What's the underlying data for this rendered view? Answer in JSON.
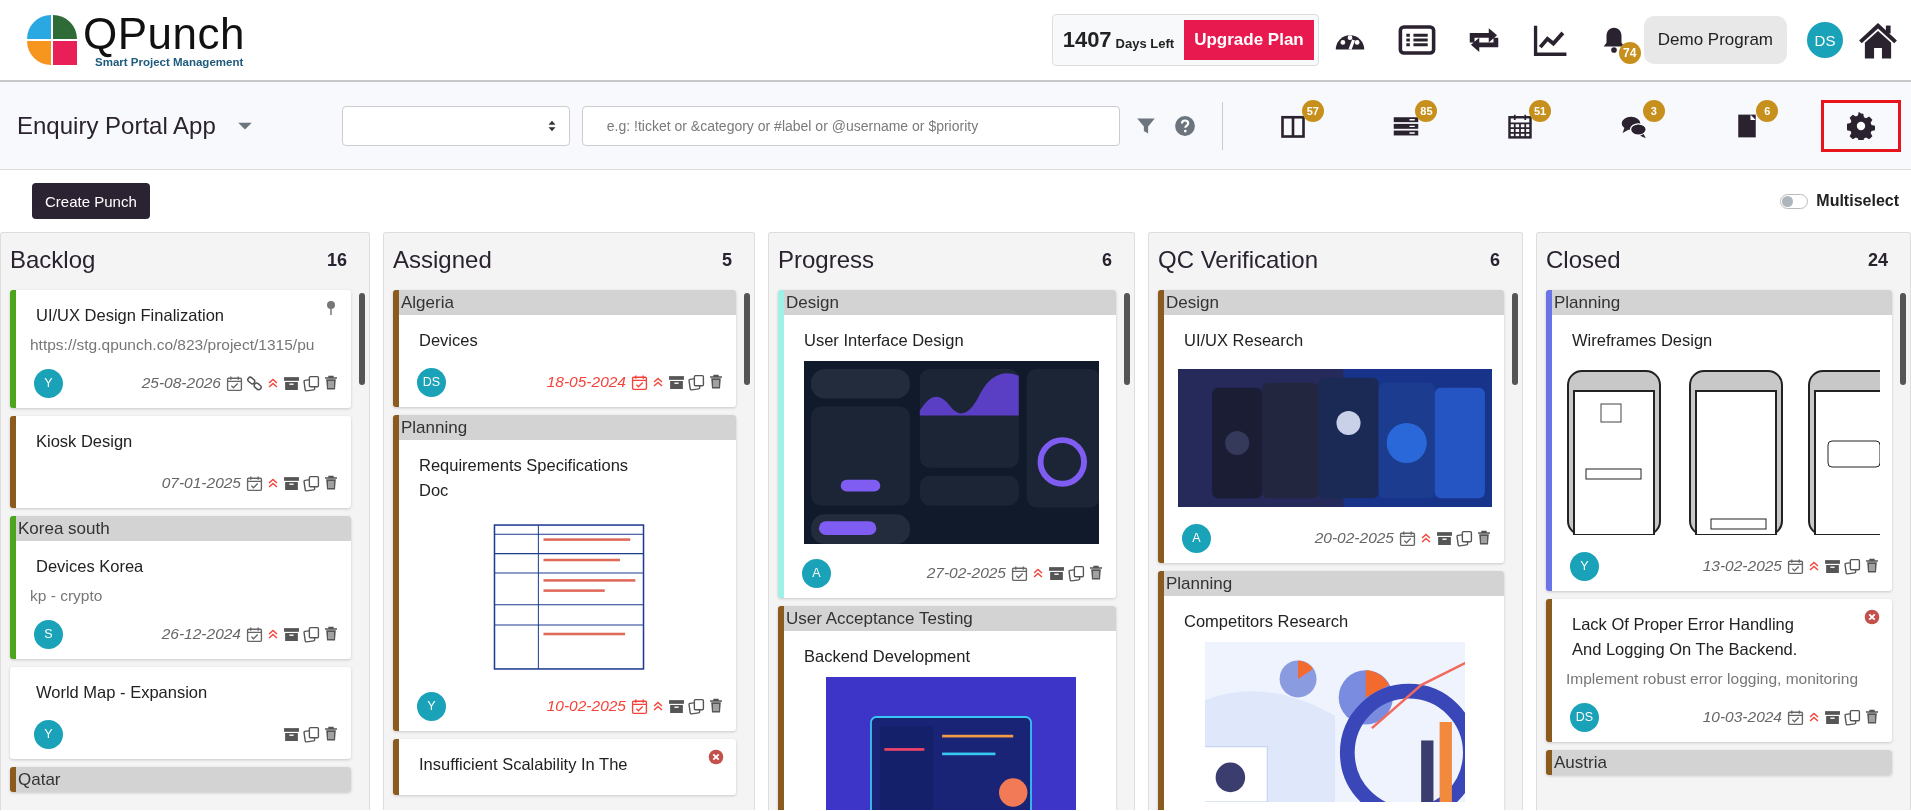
{
  "brand": {
    "name": "QPunch",
    "tagline": "Smart Project Management"
  },
  "plan": {
    "days": "1407",
    "days_label": "Days Left",
    "upgrade": "Upgrade Plan"
  },
  "nav_icons": [
    {
      "kind": "dashboard"
    },
    {
      "kind": "list"
    },
    {
      "kind": "repeat"
    },
    {
      "kind": "chart"
    },
    {
      "kind": "bell",
      "badge": "74"
    }
  ],
  "program": "Demo Program",
  "user": {
    "initials": "DS"
  },
  "project": {
    "title": "Enquiry Portal App"
  },
  "search": {
    "placeholder": "e.g: !ticket or &category or #label or @username or $priority"
  },
  "view_icons": [
    {
      "kind": "board",
      "badge": "57",
      "selected": false
    },
    {
      "kind": "stack",
      "badge": "85",
      "selected": false
    },
    {
      "kind": "calendar",
      "badge": "51",
      "selected": false
    },
    {
      "kind": "chat",
      "badge": "3",
      "selected": false
    },
    {
      "kind": "note",
      "badge": "6",
      "selected": false
    },
    {
      "kind": "settings",
      "selected": true
    }
  ],
  "create_button": "Create Punch",
  "multiselect": {
    "label": "Multiselect",
    "on": false
  },
  "columns": [
    {
      "title": "Backlog",
      "count": "16",
      "cards": [
        {
          "color": "#4ca51c",
          "title": "UI/UX Design Finalization",
          "subtitle": "https://stg.qpunch.co/823/project/1315/pu",
          "avatar": "Y",
          "date": "25-08-2026",
          "overdue": false,
          "pinned": true,
          "link": true,
          "priority": true,
          "cancel": false
        },
        {
          "color": "#8b5a1e",
          "title": "Kiosk Design",
          "date": "07-01-2025",
          "overdue": false,
          "pinned": false,
          "link": false,
          "priority": true,
          "cancel": false
        },
        {
          "group": "Korea south",
          "color": "#4ca51c",
          "title": "Devices Korea",
          "subtitle": "kp - crypto",
          "avatar": "S",
          "date": "26-12-2024",
          "overdue": false,
          "pinned": false,
          "link": false,
          "priority": true,
          "cancel": false
        },
        {
          "color": "#ffffff",
          "title": "World Map - Expansion",
          "avatar": "Y",
          "pinned": false,
          "link": false,
          "priority": false,
          "cancel": false
        },
        {
          "group": "Qatar",
          "color": "#8b5a1e"
        }
      ]
    },
    {
      "title": "Assigned",
      "count": "5",
      "cards": [
        {
          "group": "Algeria",
          "color": "#8b5a1e",
          "title": "Devices",
          "avatar": "DS",
          "date": "18-05-2024",
          "overdue": true,
          "pinned": false,
          "link": false,
          "priority": true,
          "cancel": false
        },
        {
          "group": "Planning",
          "color": "#8b5a1e",
          "title": "Requirements Specifications Doc",
          "avatar": "Y",
          "date": "10-02-2025",
          "overdue": true,
          "pinned": false,
          "link": false,
          "priority": true,
          "cancel": false
        },
        {
          "color": "#8b5a1e",
          "title": "Insufficient Scalability In The",
          "cancel": true
        }
      ]
    },
    {
      "title": "Progress",
      "count": "6",
      "cards": [
        {
          "group": "Design",
          "color": "#9ff0e6",
          "title": "User Interface Design",
          "avatar": "A",
          "date": "27-02-2025",
          "overdue": false,
          "pinned": false,
          "link": false,
          "priority": true,
          "cancel": false
        },
        {
          "group": "User Acceptance Testing",
          "color": "#8b5a1e",
          "title": "Backend Development"
        }
      ]
    },
    {
      "title": "QC Verification",
      "count": "6",
      "cards": [
        {
          "group": "Design",
          "color": "#8b5a1e",
          "title": "UI/UX Research",
          "avatar": "A",
          "date": "20-02-2025",
          "overdue": false,
          "pinned": false,
          "link": false,
          "priority": true,
          "cancel": false
        },
        {
          "group": "Planning",
          "color": "#8b5a1e",
          "title": "Competitors Research"
        }
      ]
    },
    {
      "title": "Closed",
      "count": "24",
      "cards": [
        {
          "group": "Planning",
          "color": "#6a74e6",
          "title": "Wireframes Design",
          "avatar": "Y",
          "date": "13-02-2025",
          "overdue": false,
          "pinned": false,
          "link": false,
          "priority": true,
          "cancel": false
        },
        {
          "color": "#8b5a1e",
          "title": "Lack Of Proper Error Handling And Logging On The Backend.",
          "subtitle": "Implement robust error logging, monitoring",
          "avatar": "DS",
          "date": "10-03-2024",
          "overdue": false,
          "pinned": false,
          "link": false,
          "priority": true,
          "cancel": true
        },
        {
          "group": "Austria",
          "color": "#8b5a1e"
        }
      ]
    }
  ]
}
